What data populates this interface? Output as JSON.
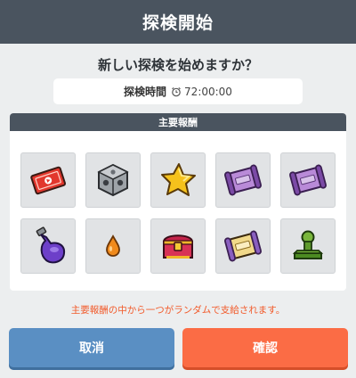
{
  "header": {
    "title": "探検開始"
  },
  "dialog": {
    "question": "新しい探検を始めますか？",
    "time_label": "探検時間",
    "time_value": "72:00:00",
    "rewards_title": "主要報酬",
    "rewards": [
      {
        "icon": "red-ticket-icon"
      },
      {
        "icon": "dice-cube-icon"
      },
      {
        "icon": "gold-star-icon"
      },
      {
        "icon": "purple-scroll-icon"
      },
      {
        "icon": "purple-scroll-icon"
      },
      {
        "icon": "purple-potion-icon"
      },
      {
        "icon": "orange-drop-icon"
      },
      {
        "icon": "treasure-chest-icon"
      },
      {
        "icon": "gold-scroll-icon"
      },
      {
        "icon": "green-stamp-icon"
      }
    ],
    "note": "主要報酬の中から一つがランダムで支給されます。"
  },
  "buttons": {
    "cancel": "取消",
    "confirm": "確認"
  },
  "colors": {
    "header_bg": "#4a545f",
    "cancel": "#5a8fc3",
    "confirm": "#fb6c45",
    "note": "#f25a2a"
  }
}
